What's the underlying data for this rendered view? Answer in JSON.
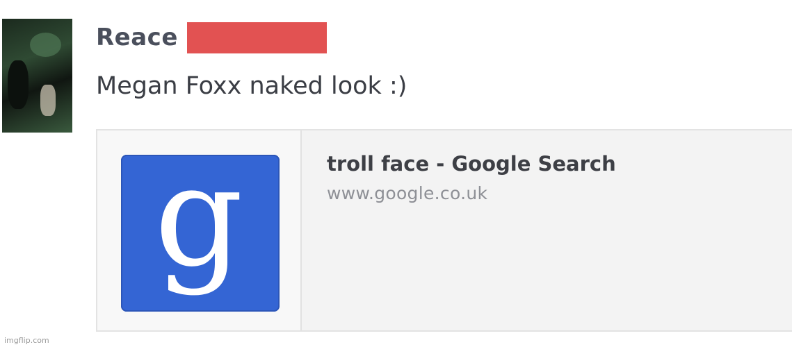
{
  "post": {
    "author_name": "Reace",
    "message": "Megan Foxx naked look :)"
  },
  "link_preview": {
    "title": "troll face - Google Search",
    "url": "www.google.co.uk",
    "thumbnail_icon": "google-g-logo",
    "thumbnail_letter": "g"
  },
  "watermark": "imgflip.com",
  "colors": {
    "redaction": "#e25252",
    "google_blue": "#3465d4"
  }
}
